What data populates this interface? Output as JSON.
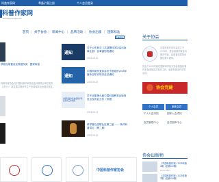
{
  "topbar": {
    "site_link": "科普作家网",
    "record": "粤备沪意注册",
    "login": "个人会员登录"
  },
  "logo": {
    "title": "科普作家网",
    "subtitle": "www.kepuzuojia.com"
  },
  "nav": {
    "items": [
      "首页",
      "关于协会",
      "新闻中心",
      "品牌活动",
      "协会出版",
      "国家标准"
    ],
    "more": "查看更多"
  },
  "left_column": {
    "caption": "获新加坡普及优秀团队奖 · 国家科普",
    "body": "科普作家协会与中国科普作家协会及科普事业单位发布（试行）》 新发展过程创作生产资源保障出台相关规定。"
  },
  "news": [
    {
      "title": "关于公布首次（共部署科学协会出版事业部）名单通知的通知",
      "meta": "2025-08-10",
      "thumb_label": "通知"
    },
    {
      "title": "中国科普作家协会关于团组织2025年度专业知识培训会议通知",
      "meta": "2025-08-20",
      "thumb_label": "通知"
    },
    {
      "title": "关于征集第九届中国科普教育出版首页点及协会业务（流程）",
      "meta": "2025-08-17",
      "thumb_label": "中国科普作家协会科学普及科普工作通知"
    },
    {
      "title": "科学普及进取社区第二届 —— 新作科普讲坛（第二届）",
      "meta": "2025-08-10",
      "thumb_label": ""
    }
  ],
  "about": {
    "title": "关于协会",
    "intro": "中国科普作家协会成立于1979年，是由科普作家及科普创作者、出版者组成的全国性群众团体。",
    "body": "协会于1990年起在国家科学技术协会管辖科普作家及团体会员相关工作，组织科普创作研究活动。"
  },
  "banner": {
    "label": "协会党建"
  },
  "member": {
    "personal": "个人会员",
    "group": "团体会员",
    "personal_link": "个人入会须知",
    "group_link": "团体入会须知",
    "personal_center": "会员管理中心",
    "group_center": "会员团体中心"
  },
  "publications": {
    "title": "协会出版物",
    "items": [
      {
        "title": "《中国科普作家》2025年第4期（总第200期）",
        "meta": "2025-08-10"
      },
      {
        "title": "《中国科普作家》2025年第3期（总第199期）",
        "meta": "2025-08-10"
      }
    ]
  },
  "partners": {
    "label_3": "中国科普作家协会"
  },
  "colors": {
    "primary": "#1f5ea8",
    "accent": "#c8282a",
    "button": "#2f73c6"
  }
}
